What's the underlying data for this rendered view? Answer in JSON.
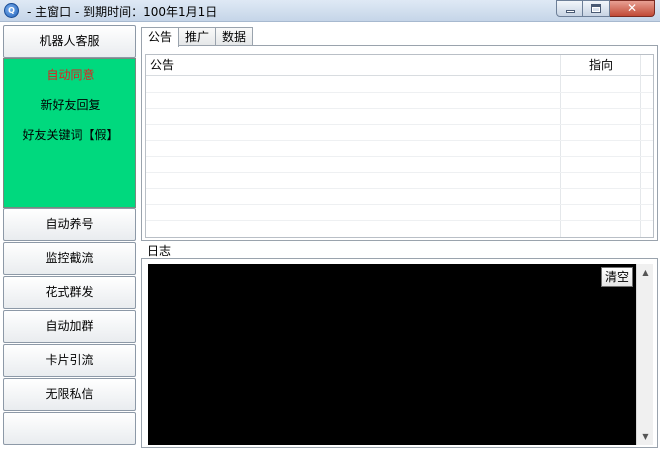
{
  "window": {
    "title": " - 主窗口 -  到期时间：100年1月1日",
    "controls": {
      "minimize": "minimize-icon",
      "maximize": "maximize-icon",
      "close": "close-icon"
    }
  },
  "sidebar": {
    "top_button": "机器人客服",
    "green_items": [
      {
        "label": "自动同意",
        "active": true
      },
      {
        "label": "新好友回复",
        "active": false
      },
      {
        "label": "好友关键词【假】",
        "active": false
      }
    ],
    "buttons": [
      "自动养号",
      "监控截流",
      "花式群发",
      "自动加群",
      "卡片引流",
      "无限私信",
      ""
    ]
  },
  "tabs": [
    "公告",
    "推广",
    "数据"
  ],
  "active_tab": "公告",
  "announcement_list": {
    "columns": [
      "公告",
      "指向"
    ],
    "rows": []
  },
  "log": {
    "label": "日志",
    "clear_button": "清空",
    "content": ""
  },
  "colors": {
    "green_panel": "#00d97e",
    "active_item": "#e02020",
    "log_background": "#000000"
  }
}
